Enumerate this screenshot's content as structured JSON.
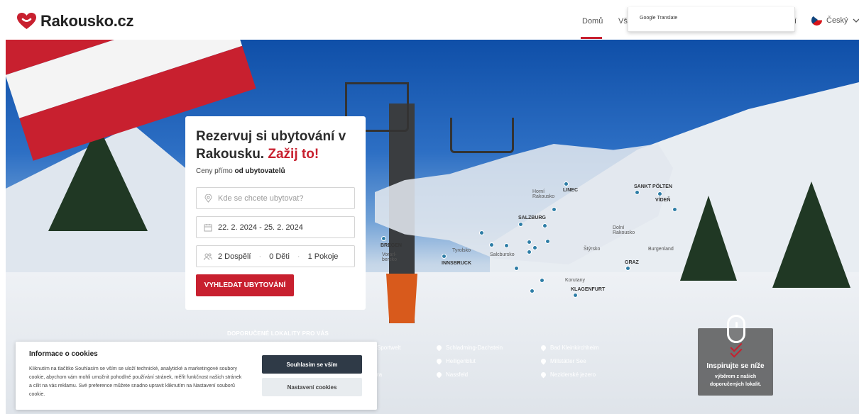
{
  "header": {
    "brand": "Rakousko.cz",
    "nav": {
      "home": "Domů",
      "all": "Vše",
      "partial": "í"
    },
    "google_translate": "Google Translate",
    "language": "Český"
  },
  "search_card": {
    "title_main": "Rezervuj si ubytování v Rakousku.",
    "title_accent": "Zažij to!",
    "subtitle_prefix": "Ceny přímo",
    "subtitle_bold": "od ubytovatelů",
    "location_placeholder": "Kde se chcete ubytovat?",
    "dates": "22. 2. 2024 - 25. 2. 2024",
    "guests": {
      "adults": "2 Dospělí",
      "children": "0 Děti",
      "rooms": "1 Pokoje"
    },
    "submit": "VYHLEDAT UBYTOVÁNÍ"
  },
  "map_labels": {
    "horni_rakousko": "Horní Rakousko",
    "linec": "LINEC",
    "sankt_polten": "SANKT PÖLTEN",
    "viden": "VÍDEŇ",
    "salzburg": "SALZBURG",
    "dolni_rakousko": "Dolní Rakousko",
    "bregenz": "BREGEN",
    "vorarlbersko": "Vorarl- bersko",
    "tyrolsko": "Tyrolsko",
    "innsbruck": "INNSBRUCK",
    "salcbursko": "Salcbursko",
    "styrsko": "Štýrsko",
    "burgenland": "Burgenland",
    "graz": "GRAZ",
    "korutany": "Korutany",
    "klagenfurt": "KLAGENFURT"
  },
  "recommended": {
    "title": "DOPORUČENÉ LOKALITY PRO VÁS",
    "locations": [
      "Sportwelt",
      "Schladming-Dachstein",
      "Bad Kleinkirchheim",
      "Heiligenblut",
      "Millstätter See",
      "ra",
      "Nassfeld",
      "Neziderské jezero"
    ]
  },
  "inspire": {
    "heading": "Inspirujte se níže",
    "text": "výběrem z našich doporučených lokalit."
  },
  "cookies": {
    "title": "Informace o cookies",
    "text": "Kliknutím na tlačítko Souhlasím se vším se uloží technické, analytické a marketingové soubory cookie, abychom vám mohli umožnit pohodlné používání stránek, měřit funkčnost našich stránek a cílit na vás reklamu. Své preference můžete snadno upravit kliknutím na Nastavení souborů cookie.",
    "accept": "Souhlasím se vším",
    "settings": "Nastavení cookies"
  },
  "colors": {
    "accent": "#c8202f",
    "dark_button": "#2f3a47",
    "map_pin": "#2e7da6"
  }
}
